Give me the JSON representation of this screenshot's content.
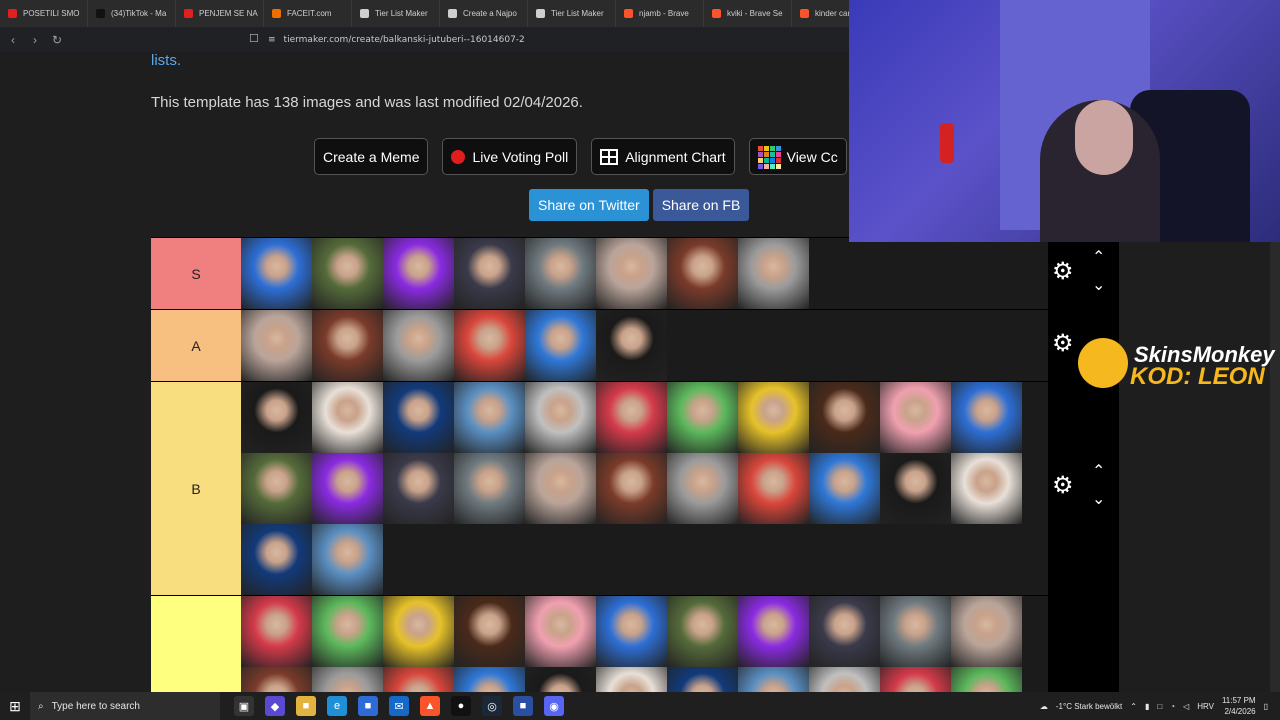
{
  "browser": {
    "tabs": [
      {
        "label": "POSETILI SMO",
        "color": "#e02020"
      },
      {
        "label": "(34)TikTok - Ma",
        "color": "#111111"
      },
      {
        "label": "PENJEM SE NA",
        "color": "#e02020"
      },
      {
        "label": "FACEIT.com",
        "color": "#f06d00"
      },
      {
        "label": "Tier List Maker",
        "color": "#cfcfcf"
      },
      {
        "label": "Create a Najpo",
        "color": "#cfcfcf"
      },
      {
        "label": "Tier List Maker",
        "color": "#cfcfcf"
      },
      {
        "label": "njamb - Brave",
        "color": "#fb542b"
      },
      {
        "label": "kviki - Brave Se",
        "color": "#fb542b"
      },
      {
        "label": "kinder car",
        "color": "#fb542b"
      }
    ],
    "url": "tiermaker.com/create/balkanski-jutuberi--16014607-2"
  },
  "page": {
    "lists_link": "lists.",
    "template_info": "This template has 138 images and was last modified 02/04/2026.",
    "buttons": {
      "meme": "Create a Meme",
      "poll": "Live Voting Poll",
      "alignment": "Alignment Chart",
      "view": "View Cc"
    },
    "share": {
      "twitter": "Share on Twitter",
      "fb": "Share on FB"
    }
  },
  "tiers": [
    {
      "label": "S",
      "color": "#f07f7f",
      "items": 8
    },
    {
      "label": "A",
      "color": "#f7bf80",
      "items": 6
    },
    {
      "label": "B",
      "color": "#f9de7f",
      "items": 24
    },
    {
      "label": "",
      "color": "#fefe7f",
      "items": 22
    }
  ],
  "item_colors": [
    "#2d6fd6",
    "#556b3a",
    "#8a2be2",
    "#3a3a4a",
    "#6f7a80",
    "#b9a49a",
    "#7a3b2a",
    "#9b9b9b",
    "#d9463b",
    "#2f78d8",
    "#1a1a1a",
    "#e8e0d8",
    "#123a7a",
    "#5a8fc2",
    "#c0c0c0",
    "#d43a4a",
    "#5cb85c",
    "#e6c229",
    "#4a2a1a",
    "#f0a0b0"
  ],
  "promo": {
    "title": "SkinsMonkey",
    "code": "KOD: LEON"
  },
  "taskbar": {
    "search_placeholder": "Type here to search",
    "weather": "-1°C  Stark bewölkt",
    "lang": "HRV",
    "time": "11:57 PM",
    "date": "2/4/2026"
  }
}
